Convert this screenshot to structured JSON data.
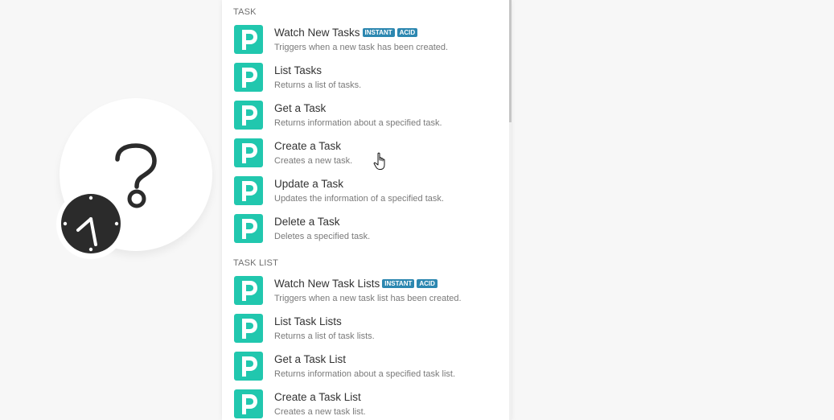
{
  "colors": {
    "app_icon_bg": "#21c7ae",
    "badge_bg": "#2c87b0",
    "panel_bg": "#ffffff",
    "canvas_bg": "#f7f7f7"
  },
  "module": {
    "icon": "question-mark-icon",
    "badge_icon": "clock-icon"
  },
  "sections": [
    {
      "header": "TASK",
      "actions": [
        {
          "title": "Watch New Tasks",
          "badges": [
            "INSTANT",
            "ACID"
          ],
          "description": "Triggers when a new task has been created."
        },
        {
          "title": "List Tasks",
          "badges": [],
          "description": "Returns a list of tasks."
        },
        {
          "title": "Get a Task",
          "badges": [],
          "description": "Returns information about a specified task."
        },
        {
          "title": "Create a Task",
          "badges": [],
          "description": "Creates a new task."
        },
        {
          "title": "Update a Task",
          "badges": [],
          "description": "Updates the information of a specified task."
        },
        {
          "title": "Delete a Task",
          "badges": [],
          "description": "Deletes a specified task."
        }
      ]
    },
    {
      "header": "TASK LIST",
      "actions": [
        {
          "title": "Watch New Task Lists",
          "badges": [
            "INSTANT",
            "ACID"
          ],
          "description": "Triggers when a new task list has been created."
        },
        {
          "title": "List Task Lists",
          "badges": [],
          "description": "Returns a list of task lists."
        },
        {
          "title": "Get a Task List",
          "badges": [],
          "description": "Returns information about a specified task list."
        },
        {
          "title": "Create a Task List",
          "badges": [],
          "description": "Creates a new task list."
        }
      ]
    }
  ]
}
